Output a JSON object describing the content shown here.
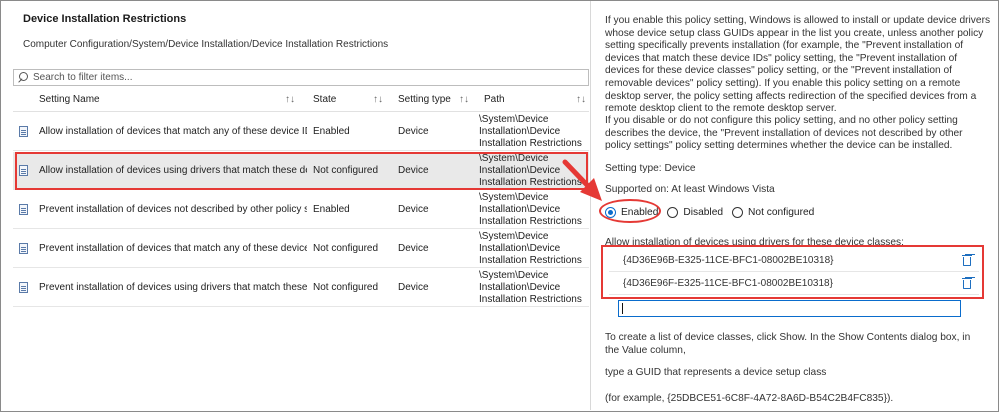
{
  "left": {
    "title": "Device Installation Restrictions",
    "path": "Computer Configuration/System/Device Installation/Device Installation Restrictions",
    "search_placeholder": "Search to filter items...",
    "columns": {
      "setting_name": "Setting Name",
      "state": "State",
      "setting_type": "Setting type",
      "path": "Path",
      "sort_glyph": "↑↓"
    },
    "rows": [
      {
        "name": "Allow installation of devices that match any of these device IDs",
        "state": "Enabled",
        "type": "Device",
        "path": [
          "\\System\\Device",
          "Installation\\Device",
          "Installation Restrictions"
        ]
      },
      {
        "name": "Allow installation of devices using drivers that match these dev...",
        "state": "Not configured",
        "type": "Device",
        "path": [
          "\\System\\Device",
          "Installation\\Device",
          "Installation Restrictions"
        ],
        "selected": true
      },
      {
        "name": "Prevent installation of devices not described by other policy set...",
        "state": "Enabled",
        "type": "Device",
        "path": [
          "\\System\\Device",
          "Installation\\Device",
          "Installation Restrictions"
        ]
      },
      {
        "name": "Prevent installation of devices that match any of these device IDs",
        "state": "Not configured",
        "type": "Device",
        "path": [
          "\\System\\Device",
          "Installation\\Device",
          "Installation Restrictions"
        ]
      },
      {
        "name": "Prevent installation of devices using drivers that match these d...",
        "state": "Not configured",
        "type": "Device",
        "path": [
          "\\System\\Device",
          "Installation\\Device",
          "Installation Restrictions"
        ]
      }
    ]
  },
  "right": {
    "description_1": "If you enable this policy setting, Windows is allowed to install or update device drivers whose device setup class GUIDs appear in the list you create, unless another policy setting specifically prevents installation (for example, the \"Prevent installation of devices that match these device IDs\" policy setting, the \"Prevent installation of devices for these device classes\" policy setting, or the \"Prevent installation of removable devices\" policy setting). If you enable this policy setting on a remote desktop server, the policy setting affects redirection of the specified devices from a remote desktop client to the remote desktop server.",
    "description_2": "If you disable or do not configure this policy setting, and no other policy setting describes the device, the \"Prevent installation of devices not described by other policy settings\" policy setting determines whether the device can be installed.",
    "setting_type": "Setting type: Device",
    "supported_on": "Supported on: At least Windows Vista",
    "radio": {
      "enabled": "Enabled",
      "disabled": "Disabled",
      "not_configured": "Not configured",
      "selected": "enabled"
    },
    "list_label": "Allow installation of devices using drivers for these device classes:",
    "guids": [
      "{4D36E96B-E325-11CE-BFC1-08002BE10318}",
      "{4D36E96F-E325-11CE-BFC1-08002BE10318}"
    ],
    "new_entry_value": "",
    "help_1": "To create a list of device classes, click Show. In the Show Contents dialog box, in the Value column,",
    "help_2": "type a GUID that represents a device setup class",
    "help_3": "(for example, {25DBCE51-6C8F-4A72-8A6D-B54C2B4FC835})."
  },
  "colors": {
    "annotation_red": "#e53935",
    "accent_blue": "#0a6ccc",
    "selected_row": "#e9e9e9"
  }
}
